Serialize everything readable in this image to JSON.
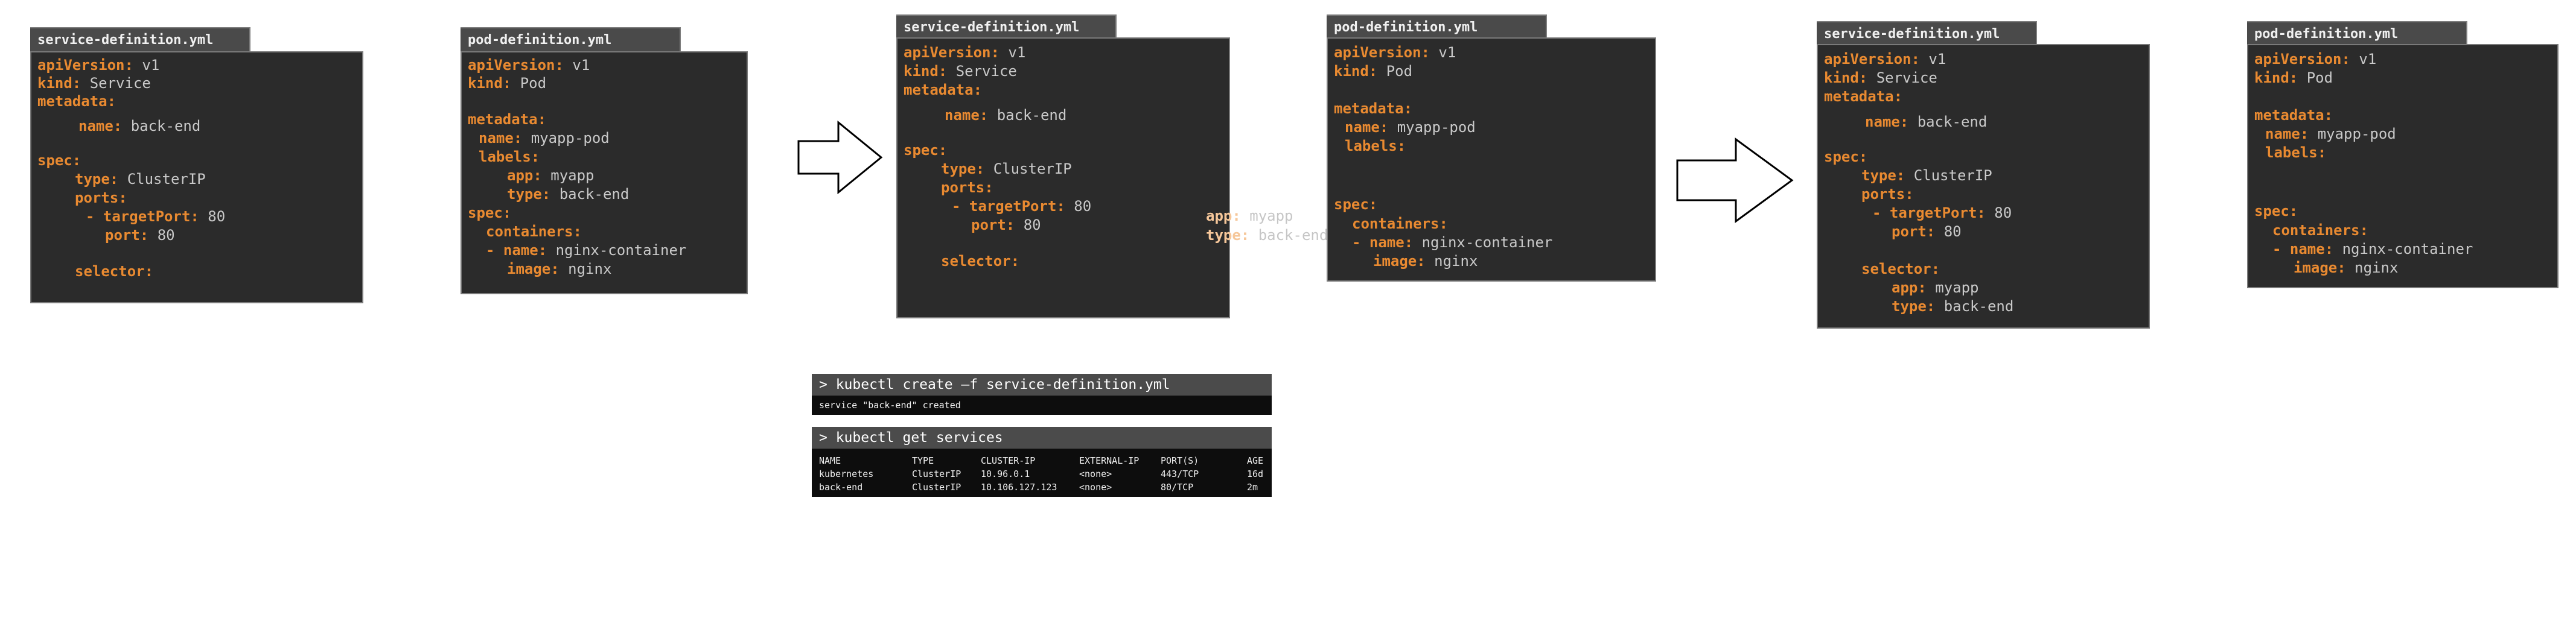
{
  "panels": [
    {
      "filename": "service-definition.yml",
      "lines": [
        {
          "key": "apiVersion:",
          "value": "v1"
        },
        {
          "key": "kind:",
          "value": "Service"
        },
        {
          "key": "metadata:",
          "value": ""
        },
        {
          "key": "name:",
          "value": "back-end"
        },
        {
          "key": "spec:",
          "value": ""
        },
        {
          "key": "type:",
          "value": "ClusterIP"
        },
        {
          "key": "ports:",
          "value": ""
        },
        {
          "key": "- targetPort:",
          "value": "80"
        },
        {
          "key": "port:",
          "value": "80"
        },
        {
          "key": "selector:",
          "value": ""
        }
      ]
    },
    {
      "filename": "pod-definition.yml",
      "lines": [
        {
          "key": "apiVersion:",
          "value": "v1"
        },
        {
          "key": "kind:",
          "value": "Pod"
        },
        {
          "key": "metadata:",
          "value": ""
        },
        {
          "key": "name:",
          "value": "myapp-pod"
        },
        {
          "key": "labels:",
          "value": ""
        },
        {
          "key": "app:",
          "value": "myapp"
        },
        {
          "key": "type:",
          "value": "back-end"
        },
        {
          "key": "spec:",
          "value": ""
        },
        {
          "key": "containers:",
          "value": ""
        },
        {
          "key": "- name:",
          "value": "nginx-container"
        },
        {
          "key": "image:",
          "value": "nginx"
        }
      ]
    },
    {
      "filename": "service-definition.yml",
      "lines": [
        {
          "key": "apiVersion:",
          "value": "v1"
        },
        {
          "key": "kind:",
          "value": "Service"
        },
        {
          "key": "metadata:",
          "value": ""
        },
        {
          "key": "name:",
          "value": "back-end"
        },
        {
          "key": "spec:",
          "value": ""
        },
        {
          "key": "type:",
          "value": "ClusterIP"
        },
        {
          "key": "ports:",
          "value": ""
        },
        {
          "key": "- targetPort:",
          "value": "80"
        },
        {
          "key": "port:",
          "value": "80"
        },
        {
          "key": "selector:",
          "value": ""
        }
      ]
    },
    {
      "filename": "pod-definition.yml",
      "lines": [
        {
          "key": "apiVersion:",
          "value": "v1"
        },
        {
          "key": "kind:",
          "value": "Pod"
        },
        {
          "key": "metadata:",
          "value": ""
        },
        {
          "key": "name:",
          "value": "myapp-pod"
        },
        {
          "key": "labels:",
          "value": ""
        },
        {
          "key": "spec:",
          "value": ""
        },
        {
          "key": "containers:",
          "value": ""
        },
        {
          "key": "- name:",
          "value": "nginx-container"
        },
        {
          "key": "image:",
          "value": "nginx"
        }
      ]
    },
    {
      "filename": "service-definition.yml",
      "lines": [
        {
          "key": "apiVersion:",
          "value": "v1"
        },
        {
          "key": "kind:",
          "value": "Service"
        },
        {
          "key": "metadata:",
          "value": ""
        },
        {
          "key": "name:",
          "value": "back-end"
        },
        {
          "key": "spec:",
          "value": ""
        },
        {
          "key": "type:",
          "value": "ClusterIP"
        },
        {
          "key": "ports:",
          "value": ""
        },
        {
          "key": "- targetPort:",
          "value": "80"
        },
        {
          "key": "port:",
          "value": "80"
        },
        {
          "key": "selector:",
          "value": ""
        },
        {
          "key": "app:",
          "value": "myapp"
        },
        {
          "key": "type:",
          "value": "back-end"
        }
      ]
    },
    {
      "filename": "pod-definition.yml",
      "lines": [
        {
          "key": "apiVersion:",
          "value": "v1"
        },
        {
          "key": "kind:",
          "value": "Pod"
        },
        {
          "key": "metadata:",
          "value": ""
        },
        {
          "key": "name:",
          "value": "myapp-pod"
        },
        {
          "key": "labels:",
          "value": ""
        },
        {
          "key": "spec:",
          "value": ""
        },
        {
          "key": "containers:",
          "value": ""
        },
        {
          "key": "- name:",
          "value": "nginx-container"
        },
        {
          "key": "image:",
          "value": "nginx"
        }
      ]
    }
  ],
  "floating_labels": [
    {
      "key": "app:",
      "value": "myapp"
    },
    {
      "key": "type:",
      "value": "back-end"
    }
  ],
  "terminal_create": {
    "command": "> kubectl create –f service-definition.yml",
    "output": "service \"back-end\" created"
  },
  "terminal_get": {
    "command": "> kubectl get services",
    "headers": [
      "NAME",
      "TYPE",
      "CLUSTER-IP",
      "EXTERNAL-IP",
      "PORT(S)",
      "AGE"
    ],
    "rows": [
      [
        "kubernetes",
        "ClusterIP",
        "10.96.0.1",
        "<none>",
        "443/TCP",
        "16d"
      ],
      [
        "back-end",
        "ClusterIP",
        "10.106.127.123",
        "<none>",
        "80/TCP",
        "2m"
      ]
    ]
  },
  "colors": {
    "key": "#e98a31",
    "value": "#c9c9c9",
    "code_background": "#2b2b2b",
    "tab_background": "#4a4a4a",
    "terminal_background": "#0d0d0d",
    "terminal_bar": "#4b4b4b"
  },
  "icons": [
    "right-arrow-icon",
    "right-arrow-icon"
  ]
}
